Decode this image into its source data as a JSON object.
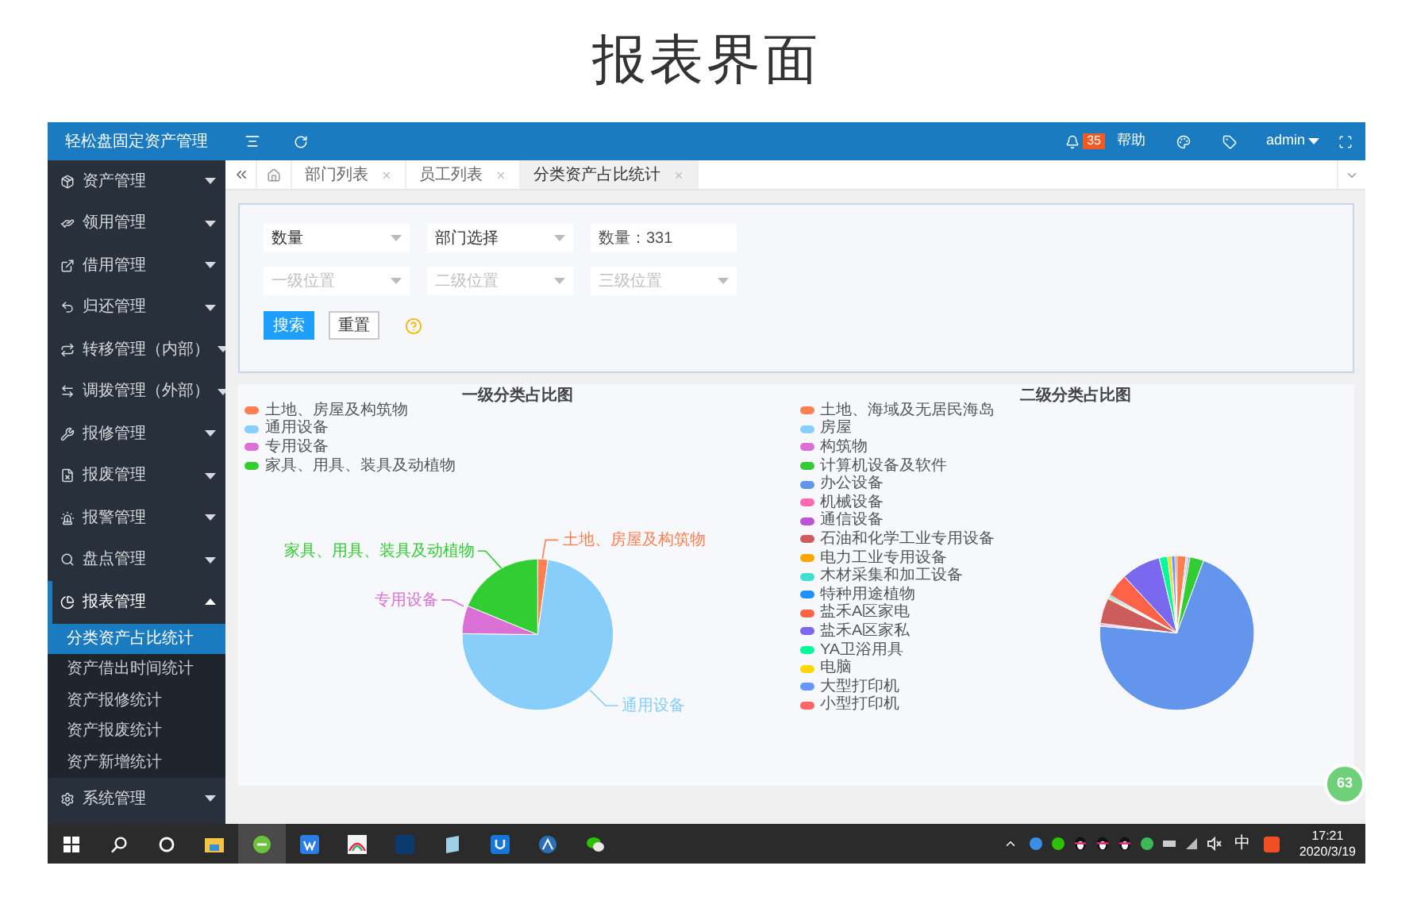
{
  "page_title": "报表界面",
  "header": {
    "app_name": "轻松盘固定资产管理",
    "notification_count": "35",
    "help": "帮助",
    "user": "admin"
  },
  "sidebar": {
    "items": [
      {
        "label": "资产管理",
        "expanded": false,
        "selected": false
      },
      {
        "label": "领用管理",
        "expanded": false,
        "selected": false
      },
      {
        "label": "借用管理",
        "expanded": false,
        "selected": false
      },
      {
        "label": "归还管理",
        "expanded": false,
        "selected": false
      },
      {
        "label": "转移管理（内部）",
        "expanded": false,
        "selected": false
      },
      {
        "label": "调拨管理（外部）",
        "expanded": false,
        "selected": false
      },
      {
        "label": "报修管理",
        "expanded": false,
        "selected": false
      },
      {
        "label": "报废管理",
        "expanded": false,
        "selected": false
      },
      {
        "label": "报警管理",
        "expanded": false,
        "selected": false
      },
      {
        "label": "盘点管理",
        "expanded": false,
        "selected": false
      },
      {
        "label": "报表管理",
        "expanded": true,
        "selected": true,
        "children": [
          {
            "label": "分类资产占比统计",
            "selected": true
          },
          {
            "label": "资产借出时间统计",
            "selected": false
          },
          {
            "label": "资产报修统计",
            "selected": false
          },
          {
            "label": "资产报废统计",
            "selected": false
          },
          {
            "label": "资产新增统计",
            "selected": false
          }
        ]
      },
      {
        "label": "系统管理",
        "expanded": false,
        "selected": false
      }
    ]
  },
  "tabs": [
    {
      "label": "部门列表",
      "selected": false
    },
    {
      "label": "员工列表",
      "selected": false
    },
    {
      "label": "分类资产占比统计",
      "selected": true
    }
  ],
  "search_form": {
    "selects": [
      {
        "value": "数量"
      },
      {
        "value": "部门选择"
      }
    ],
    "count_field": {
      "value": "数量：331"
    },
    "location_selects": [
      {
        "placeholder": "一级位置"
      },
      {
        "placeholder": "二级位置"
      },
      {
        "placeholder": "三级位置"
      }
    ],
    "buttons": [
      {
        "label": "搜索",
        "kind": "primary"
      },
      {
        "label": "重置",
        "kind": "default"
      }
    ]
  },
  "charts": [
    {
      "title": "一级分类占比图",
      "legend": [
        {
          "label": "土地、房屋及构筑物",
          "color": "#ff7f50"
        },
        {
          "label": "通用设备",
          "color": "#87cefa"
        },
        {
          "label": "专用设备",
          "color": "#da70d6"
        },
        {
          "label": "家具、用具、装具及动植物",
          "color": "#32cd32"
        }
      ],
      "slice_labels": [
        "土地、房屋及构筑物",
        "通用设备",
        "专用设备",
        "家具、用具、装具及动植物"
      ]
    },
    {
      "title": "二级分类占比图",
      "legend": [
        {
          "label": "土地、海域及无居民海岛",
          "color": "#ff7f50"
        },
        {
          "label": "房屋",
          "color": "#87cefa"
        },
        {
          "label": "构筑物",
          "color": "#da70d6"
        },
        {
          "label": "计算机设备及软件",
          "color": "#32cd32"
        },
        {
          "label": "办公设备",
          "color": "#6495ed"
        },
        {
          "label": "机械设备",
          "color": "#ff69b4"
        },
        {
          "label": "通信设备",
          "color": "#ba55d3"
        },
        {
          "label": "石油和化学工业专用设备",
          "color": "#cd5c5c"
        },
        {
          "label": "电力工业专用设备",
          "color": "#ffa500"
        },
        {
          "label": "木材采集和加工设备",
          "color": "#40e0d0"
        },
        {
          "label": "特种用途植物",
          "color": "#1e90ff"
        },
        {
          "label": "盐禾A区家电",
          "color": "#ff6347"
        },
        {
          "label": "盐禾A区家私",
          "color": "#7b68ee"
        },
        {
          "label": "YA卫浴用具",
          "color": "#00fa9a"
        },
        {
          "label": "电脑",
          "color": "#ffd700"
        },
        {
          "label": "大型打印机",
          "color": "#6699ff"
        },
        {
          "label": "小型打印机",
          "color": "#ff6666"
        }
      ]
    }
  ],
  "float_badge": "63",
  "taskbar": {
    "ime": "中",
    "time": "17:21",
    "date": "2020/3/19"
  }
}
